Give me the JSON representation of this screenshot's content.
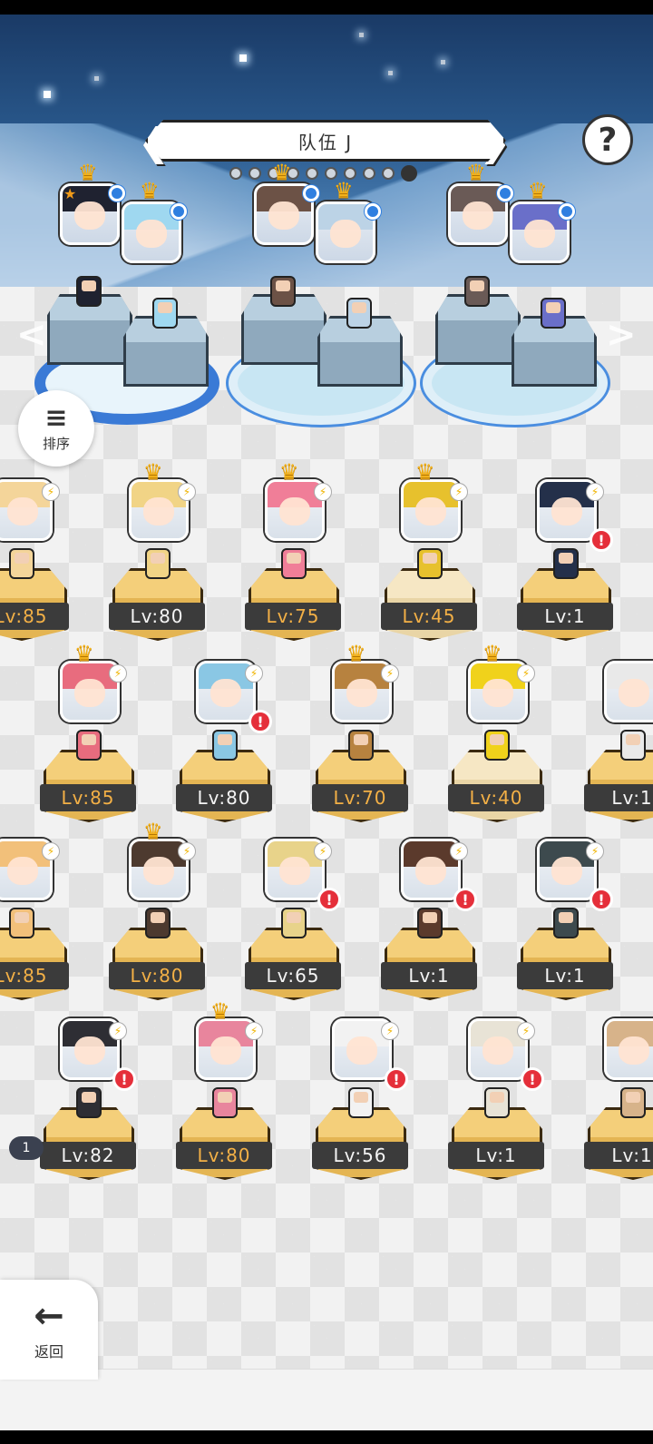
{
  "team": {
    "name": "队伍 J",
    "page_count": 10,
    "active_page": 10
  },
  "help": {
    "label": "?"
  },
  "sort": {
    "label": "排序",
    "icon": "sort-icon"
  },
  "back": {
    "label": "返回",
    "icon": "arrow-left-icon"
  },
  "nav": {
    "left": "<",
    "right": ">"
  },
  "team_slots": [
    {
      "members": [
        {
          "hair": "#1f2230",
          "crown": true,
          "badge_blue": true,
          "badge_star": true
        },
        {
          "hair": "#9fd8f0",
          "crown": true,
          "badge_blue": true
        }
      ]
    },
    {
      "members": [
        {
          "hair": "#6c5246",
          "crown": true,
          "badge_blue": true
        },
        {
          "hair": "#bcd3e6",
          "crown": true,
          "badge_blue": true
        }
      ]
    },
    {
      "members": [
        {
          "hair": "#6a5a56",
          "crown": true,
          "badge_blue": true
        },
        {
          "hair": "#6a6fc9",
          "crown": true,
          "badge_blue": true
        }
      ]
    }
  ],
  "roster": [
    {
      "level": "Lv:85",
      "gold": true,
      "crown": false,
      "alert": false,
      "hair": "#f4d59a"
    },
    {
      "level": "Lv:80",
      "gold": false,
      "crown": true,
      "alert": false,
      "hair": "#f1d486"
    },
    {
      "level": "Lv:75",
      "gold": true,
      "crown": true,
      "alert": false,
      "hair": "#f07e98"
    },
    {
      "level": "Lv:45",
      "gold": true,
      "crown": true,
      "alert": false,
      "hair": "#e7c12d",
      "pale": true
    },
    {
      "level": "Lv:1",
      "gold": false,
      "crown": false,
      "alert": true,
      "hair": "#24304a"
    },
    {
      "level": "Lv:85",
      "gold": true,
      "crown": true,
      "alert": false,
      "hair": "#e86c7e"
    },
    {
      "level": "Lv:80",
      "gold": false,
      "crown": false,
      "alert": true,
      "hair": "#8ac7e4"
    },
    {
      "level": "Lv:70",
      "gold": true,
      "crown": true,
      "alert": false,
      "hair": "#b7823f"
    },
    {
      "level": "Lv:40",
      "gold": true,
      "crown": true,
      "alert": false,
      "hair": "#f0d21b",
      "pale": true
    },
    {
      "level": "Lv:1",
      "gold": false,
      "crown": false,
      "alert": true,
      "hair": "#e9e9e9"
    },
    {
      "level": "Lv:85",
      "gold": true,
      "crown": false,
      "alert": false,
      "hair": "#f2c07a"
    },
    {
      "level": "Lv:80",
      "gold": true,
      "crown": true,
      "alert": false,
      "hair": "#4d3a2f"
    },
    {
      "level": "Lv:65",
      "gold": false,
      "crown": false,
      "alert": true,
      "hair": "#e8d38a"
    },
    {
      "level": "Lv:1",
      "gold": false,
      "crown": false,
      "alert": true,
      "hair": "#5b3a2c"
    },
    {
      "level": "Lv:1",
      "gold": false,
      "crown": false,
      "alert": true,
      "hair": "#3d4a4e"
    },
    {
      "level": "Lv:82",
      "gold": false,
      "crown": false,
      "alert": true,
      "hair": "#2e2e34"
    },
    {
      "level": "Lv:80",
      "gold": true,
      "crown": true,
      "alert": false,
      "hair": "#e8859d"
    },
    {
      "level": "Lv:56",
      "gold": false,
      "crown": false,
      "alert": true,
      "hair": "#f2f2f2"
    },
    {
      "level": "Lv:1",
      "gold": false,
      "crown": false,
      "alert": true,
      "hair": "#e8e3d6"
    },
    {
      "level": "Lv:1",
      "gold": false,
      "crown": false,
      "alert": true,
      "hair": "#d7b38a"
    }
  ],
  "stack_badge": {
    "label": "1"
  }
}
